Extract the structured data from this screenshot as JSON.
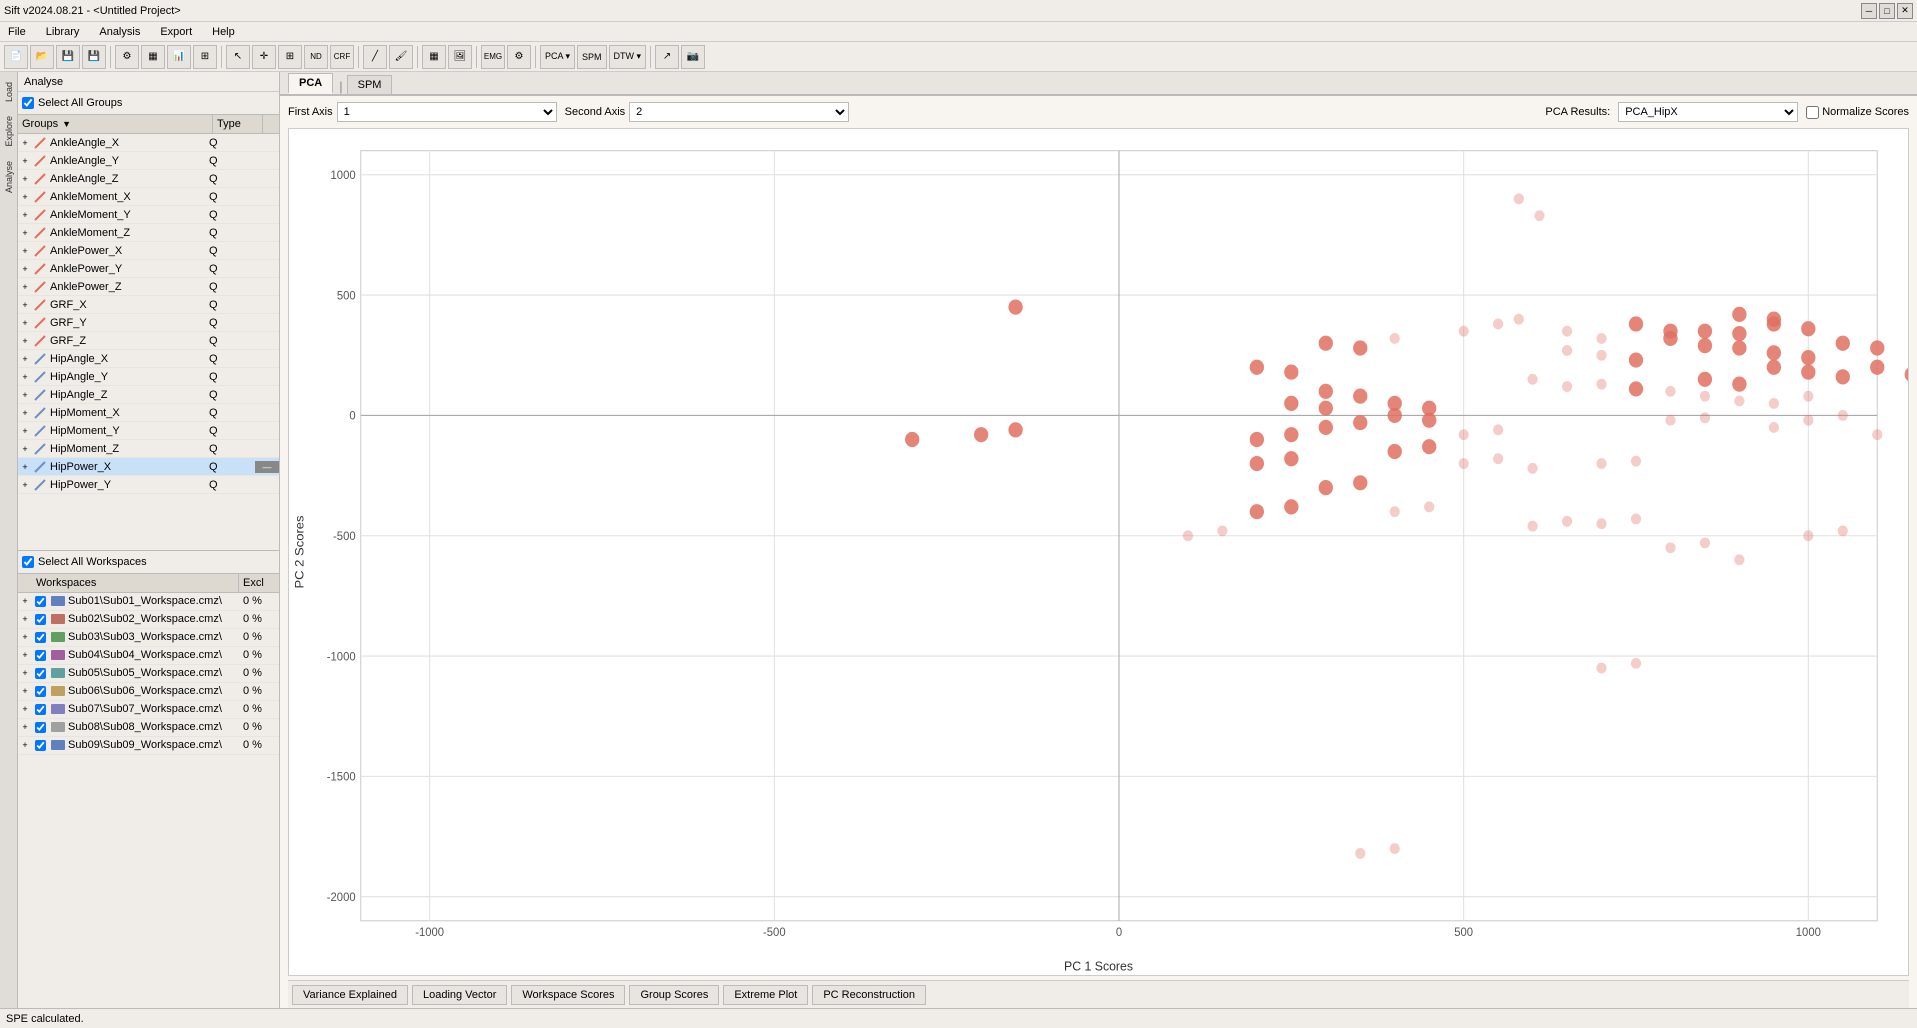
{
  "title": "Sift v2024.08.21 - <Untitled Project>",
  "menu": {
    "items": [
      "File",
      "Library",
      "Analysis",
      "Export",
      "Help"
    ]
  },
  "sidebar": {
    "tabs": [
      "Load",
      "Explore",
      "Analyse"
    ]
  },
  "analyse_label": "Analyse",
  "groups": {
    "select_all_label": "Select All Groups",
    "col_groups": "Groups",
    "col_type": "Type",
    "items": [
      {
        "name": "AnkleAngle_X",
        "type": "Q",
        "color": "#e07060"
      },
      {
        "name": "AnkleAngle_Y",
        "type": "Q",
        "color": "#e07060"
      },
      {
        "name": "AnkleAngle_Z",
        "type": "Q",
        "color": "#e07060"
      },
      {
        "name": "AnkleMoment_X",
        "type": "Q",
        "color": "#e07060"
      },
      {
        "name": "AnkleMoment_Y",
        "type": "Q",
        "color": "#e07060"
      },
      {
        "name": "AnkleMoment_Z",
        "type": "Q",
        "color": "#e07060"
      },
      {
        "name": "AnklePower_X",
        "type": "Q",
        "color": "#e07060"
      },
      {
        "name": "AnklePower_Y",
        "type": "Q",
        "color": "#e07060"
      },
      {
        "name": "AnklePower_Z",
        "type": "Q",
        "color": "#e07060"
      },
      {
        "name": "GRF_X",
        "type": "Q",
        "color": "#e07060"
      },
      {
        "name": "GRF_Y",
        "type": "Q",
        "color": "#e07060"
      },
      {
        "name": "GRF_Z",
        "type": "Q",
        "color": "#e07060"
      },
      {
        "name": "HipAngle_X",
        "type": "Q",
        "color": "#7090c0"
      },
      {
        "name": "HipAngle_Y",
        "type": "Q",
        "color": "#7090c0"
      },
      {
        "name": "HipAngle_Z",
        "type": "Q",
        "color": "#7090c0"
      },
      {
        "name": "HipMoment_X",
        "type": "Q",
        "color": "#7090c0"
      },
      {
        "name": "HipMoment_Y",
        "type": "Q",
        "color": "#7090c0"
      },
      {
        "name": "HipMoment_Z",
        "type": "Q",
        "color": "#7090c0"
      },
      {
        "name": "HipPower_X",
        "type": "Q",
        "color": "#7090c0",
        "selected": true
      },
      {
        "name": "HipPower_Y",
        "type": "Q",
        "color": "#7090c0"
      }
    ]
  },
  "workspaces": {
    "select_all_label": "Select All Workspaces",
    "col_ws": "Workspaces",
    "col_excl": "Excl",
    "items": [
      {
        "name": "Sub01\\Sub01_Workspace.cmz\\",
        "excl": "0 %",
        "checked": true,
        "color": "#6080c0"
      },
      {
        "name": "Sub02\\Sub02_Workspace.cmz\\",
        "excl": "0 %",
        "checked": true,
        "color": "#c07060"
      },
      {
        "name": "Sub03\\Sub03_Workspace.cmz\\",
        "excl": "0 %",
        "checked": true,
        "color": "#60a060"
      },
      {
        "name": "Sub04\\Sub04_Workspace.cmz\\",
        "excl": "0 %",
        "checked": true,
        "color": "#a060a0"
      },
      {
        "name": "Sub05\\Sub05_Workspace.cmz\\",
        "excl": "0 %",
        "checked": true,
        "color": "#60a0a0"
      },
      {
        "name": "Sub06\\Sub06_Workspace.cmz\\",
        "excl": "0 %",
        "checked": true,
        "color": "#c0a060"
      },
      {
        "name": "Sub07\\Sub07_Workspace.cmz\\",
        "excl": "0 %",
        "checked": true,
        "color": "#8080c0"
      },
      {
        "name": "Sub08\\Sub08_Workspace.cmz\\",
        "excl": "0 %",
        "checked": true,
        "color": "#a0a0a0"
      },
      {
        "name": "Sub09\\Sub09_Workspace.cmz\\",
        "excl": "0 %",
        "checked": true,
        "color": "#6080c0"
      }
    ]
  },
  "pca": {
    "tabs": [
      "PCA",
      "SPM"
    ],
    "active_tab": "PCA",
    "results_label": "PCA Results:",
    "results_value": "PCA_HipX",
    "first_axis_label": "First Axis",
    "first_axis_value": "1",
    "second_axis_label": "Second Axis",
    "second_axis_value": "2",
    "normalize_label": "Normalize Scores",
    "x_axis_label": "PC 1 Scores",
    "y_axis_label": "PC 2 Scores",
    "x_min": -1000,
    "x_max": 1000,
    "y_min": -2000,
    "y_max": 1000
  },
  "bottom_tabs": {
    "items": [
      "Variance Explained",
      "Loading Vector",
      "Workspace Scores",
      "Group Scores",
      "Extreme Plot",
      "PC Reconstruction"
    ]
  },
  "status": "SPE calculated."
}
